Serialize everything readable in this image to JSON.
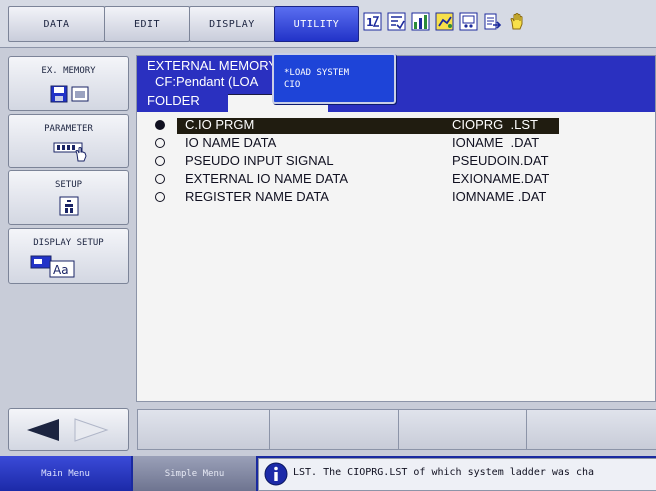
{
  "menu": {
    "tabs": [
      {
        "label": "DATA",
        "active": false
      },
      {
        "label": "EDIT",
        "active": false
      },
      {
        "label": "DISPLAY",
        "active": false
      },
      {
        "label": "UTILITY",
        "active": true
      }
    ],
    "toolbar_icons": [
      "io-icon",
      "job-check-icon",
      "chart-icon",
      "robot-dog-icon",
      "panel-icon",
      "document-arrow-icon",
      "hand-icon"
    ]
  },
  "left_panel": {
    "buttons": [
      {
        "label": "EX. MEMORY",
        "icon": "memory-icon"
      },
      {
        "label": "PARAMETER",
        "icon": "parameter-icon"
      },
      {
        "label": "SETUP",
        "icon": "setup-icon"
      },
      {
        "label": "DISPLAY SETUP",
        "icon": "display-setup-icon"
      }
    ]
  },
  "header": {
    "line1": "EXTERNAL MEMORY",
    "line2": "CF:Pendant (LOA",
    "line3": "FOLDER"
  },
  "dropdown": {
    "items": [
      "*LOAD SYSTEM",
      "CIO"
    ]
  },
  "file_list": [
    {
      "name": "C.IO PRGM",
      "file": "CIOPRG  .LST",
      "selected": true
    },
    {
      "name": "IO NAME DATA",
      "file": "IONAME  .DAT",
      "selected": false
    },
    {
      "name": "PSEUDO INPUT SIGNAL",
      "file": "PSEUDOIN.DAT",
      "selected": false
    },
    {
      "name": "EXTERNAL IO NAME DATA",
      "file": "EXIONAME.DAT",
      "selected": false
    },
    {
      "name": "REGISTER NAME DATA",
      "file": "IOMNAME .DAT",
      "selected": false
    }
  ],
  "status_bar": {
    "main_menu": "Main Menu",
    "simple_menu": "Simple Menu",
    "message": "LST. The CIOPRG.LST of which system ladder was cha"
  },
  "colors": {
    "accent": "#2a30c0",
    "tab_active": "#2233c8",
    "status_bar": "#1a2aa0"
  }
}
